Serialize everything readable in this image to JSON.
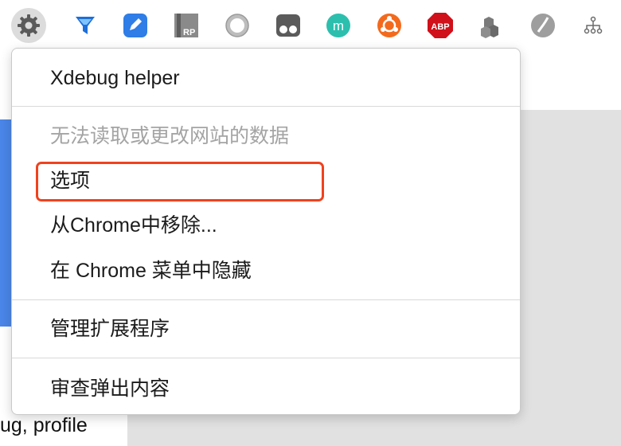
{
  "toolbar": {
    "extensions": [
      {
        "name": "settings-gear-icon",
        "active": true
      },
      {
        "name": "funnel-icon"
      },
      {
        "name": "pencil-badge-icon"
      },
      {
        "name": "rp-icon",
        "glyph": "RP"
      },
      {
        "name": "ring-icon"
      },
      {
        "name": "tampermonkey-icon"
      },
      {
        "name": "m-circle-icon",
        "glyph": "m"
      },
      {
        "name": "orange-network-icon"
      },
      {
        "name": "adblock-plus-icon",
        "glyph": "ABP"
      },
      {
        "name": "blocks-icon"
      },
      {
        "name": "grey-swirl-icon"
      },
      {
        "name": "sitemap-icon"
      }
    ]
  },
  "menu": {
    "header": "Xdebug helper",
    "site_access": "无法读取或更改网站的数据",
    "options": "选项",
    "remove": "从Chrome中移除...",
    "hide": "在 Chrome 菜单中隐藏",
    "manage": "管理扩展程序",
    "inspect": "审查弹出内容"
  },
  "background": {
    "partial_text": "ug, profile"
  },
  "colors": {
    "highlight": "#f0421e",
    "disabled_text": "#a4a4a4",
    "accent_blue": "#4a86e8"
  }
}
